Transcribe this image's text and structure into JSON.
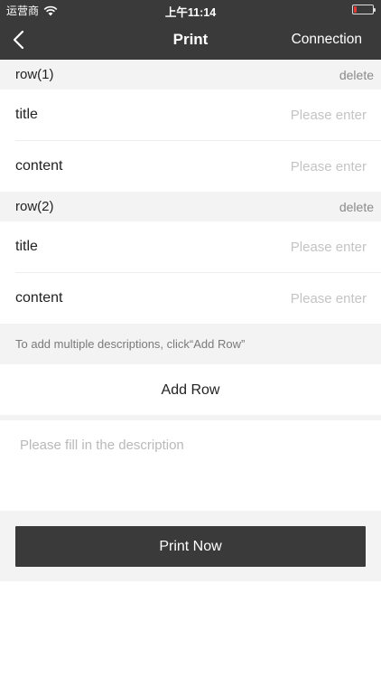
{
  "status_bar": {
    "carrier": "运营商",
    "time": "上午11:14",
    "battery_level": 0.15,
    "battery_color": "#e53935"
  },
  "nav": {
    "back_icon": "chevron-left-icon",
    "title": "Print",
    "right_button": "Connection"
  },
  "rows": [
    {
      "header": "row(1)",
      "delete_label": "delete",
      "fields": [
        {
          "label": "title",
          "value": "",
          "placeholder": "Please enter"
        },
        {
          "label": "content",
          "value": "",
          "placeholder": "Please enter"
        }
      ]
    },
    {
      "header": "row(2)",
      "delete_label": "delete",
      "fields": [
        {
          "label": "title",
          "value": "",
          "placeholder": "Please enter"
        },
        {
          "label": "content",
          "value": "",
          "placeholder": "Please enter"
        }
      ]
    }
  ],
  "hint": "To add multiple descriptions, click“Add Row”",
  "add_row_label": "Add Row",
  "description": {
    "value": "",
    "placeholder": "Please fill in the description"
  },
  "print_button": "Print Now",
  "colors": {
    "nav_background": "#3a3a3a",
    "section_background": "#f3f3f3",
    "primary_button": "#3a3a3a",
    "placeholder": "#c4c4c4"
  }
}
